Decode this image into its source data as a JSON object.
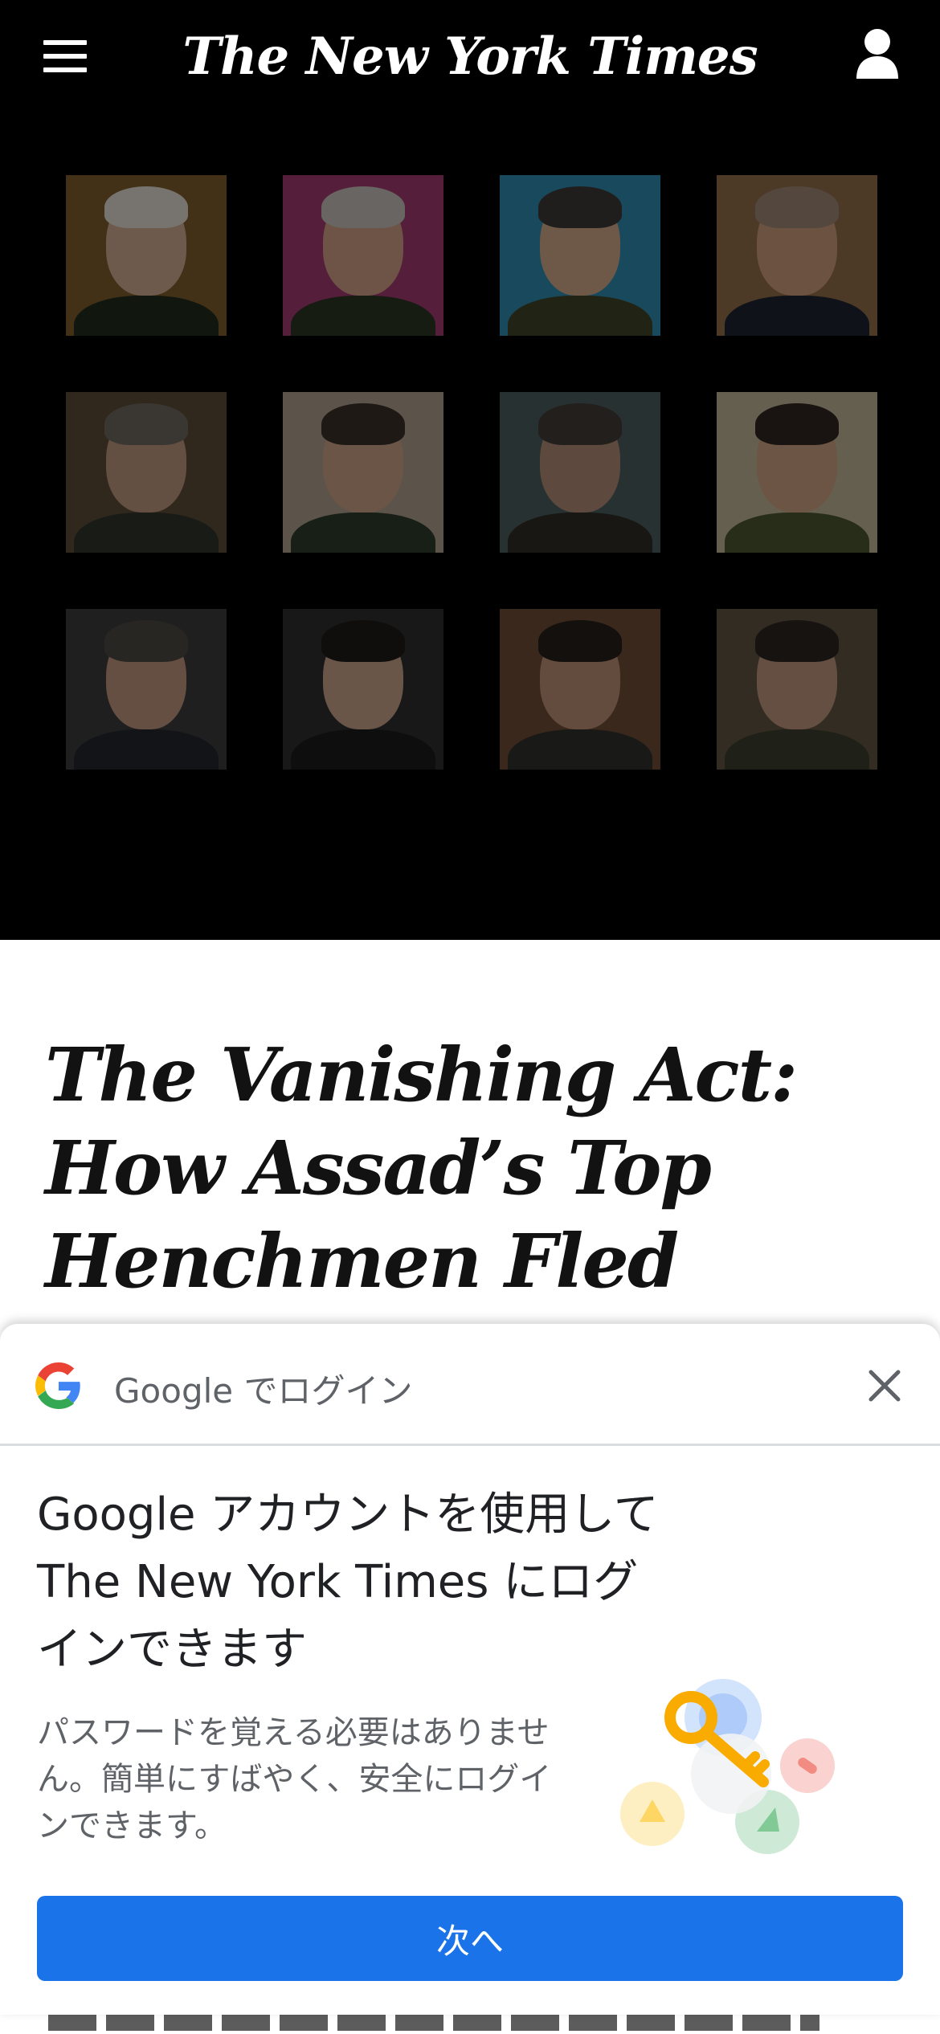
{
  "header": {
    "logo_text": "The New York Times"
  },
  "hero": {
    "portraits": [
      {
        "bg": "#7a5a2a",
        "skin": "#c9a58c",
        "hair": "#d9d4cc",
        "body": "#1f2a1c"
      },
      {
        "bg": "#9b3a6e",
        "skin": "#c79a82",
        "hair": "#bdb8b2",
        "body": "#2b3323"
      },
      {
        "bg": "#2f86a8",
        "skin": "#c8a083",
        "hair": "#3b3834",
        "body": "#3c4226"
      },
      {
        "bg": "#8a6a45",
        "skin": "#c59677",
        "hair": "#9a8272",
        "body": "#1e2230"
      },
      {
        "bg": "#5a4a36",
        "skin": "#b6907a",
        "hair": "#6a655e",
        "body": "#2f3228"
      },
      {
        "bg": "#a89a88",
        "skin": "#c49b80",
        "hair": "#3a2f28",
        "body": "#2a3a2a"
      },
      {
        "bg": "#4a5a5a",
        "skin": "#a98672",
        "hair": "#3f3a35",
        "body": "#2c2a24"
      },
      {
        "bg": "#b9ad92",
        "skin": "#c59c7c",
        "hair": "#2e2620",
        "body": "#4a5230"
      },
      {
        "bg": "#3a3a3a",
        "skin": "#b88e78",
        "hair": "#4a453f",
        "body": "#22252b"
      },
      {
        "bg": "#2c2c2c",
        "skin": "#c29c86",
        "hair": "#1d1a18",
        "body": "#1a1a1a"
      },
      {
        "bg": "#6a4a34",
        "skin": "#b58a70",
        "hair": "#231e1a",
        "body": "#2f2f2a"
      },
      {
        "bg": "#5e503e",
        "skin": "#b8917a",
        "hair": "#2a241f",
        "body": "#3a3c2c"
      }
    ]
  },
  "article": {
    "headline": "The Vanishing Act: How Assad’s Top Henchmen Fled Syria, and Justice"
  },
  "google_sheet": {
    "title": "Google でログイン",
    "heading": "Google アカウントを使用して The New York Times にログインできます",
    "description": "パスワードを覚える必要はありません。簡単にすばやく、安全にログインできます。",
    "next_label": "次へ",
    "colors": {
      "blue": "#4285F4",
      "red": "#EA4335",
      "yellow": "#FBBC05",
      "green": "#34A853",
      "button": "#1a73e8"
    }
  }
}
